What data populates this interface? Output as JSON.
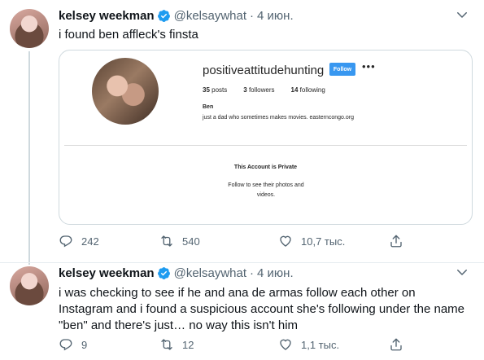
{
  "tweets": [
    {
      "name": "kelsey weekman",
      "handle": "@kelsaywhat",
      "separator": "·",
      "date": "4 июн.",
      "text": "i found ben affleck's finsta",
      "embed": {
        "username": "positiveattitudehunting",
        "follow_label": "Follow",
        "more": "•••",
        "posts_count": "35",
        "posts_label": "posts",
        "followers_count": "3",
        "followers_label": "followers",
        "following_count": "14",
        "following_label": "following",
        "display_name": "Ben",
        "bio": "just a dad who sometimes makes movies. easterncongo.org",
        "private_title": "This Account is Private",
        "private_subtitle": "Follow to see their photos and videos."
      },
      "replies": "242",
      "retweets": "540",
      "likes": "10,7 тыс."
    },
    {
      "name": "kelsey weekman",
      "handle": "@kelsaywhat",
      "separator": "·",
      "date": "4 июн.",
      "text": "i was checking to see if he and ana de armas follow each other on Instagram and i found a suspicious account she's following under the name \"ben\" and there's just… no way this isn't him",
      "replies": "9",
      "retweets": "12",
      "likes": "1,1 тыс."
    }
  ],
  "colors": {
    "accent": "#1d9bf0",
    "muted": "#536471",
    "follow": "#3897f0"
  }
}
